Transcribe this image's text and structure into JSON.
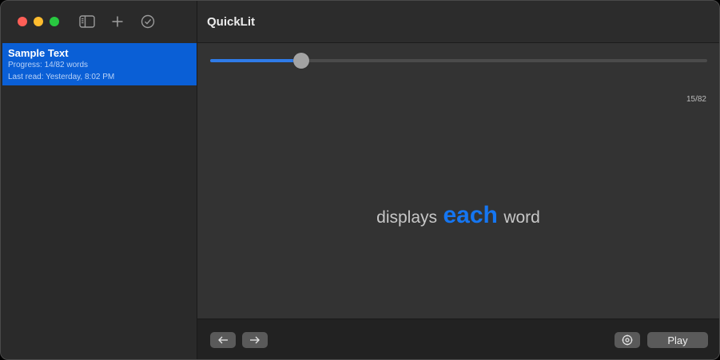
{
  "sidebar": {
    "toolbar": {
      "icons": [
        "sidebar-toggle-icon",
        "plus-icon",
        "checkmark-circle-icon"
      ]
    },
    "items": [
      {
        "title": "Sample Text",
        "progress": "Progress: 14/82 words",
        "last_read": "Last read: Yesterday, 8:02 PM",
        "selected": true
      }
    ]
  },
  "header": {
    "title": "QuickLit"
  },
  "reader": {
    "progress_fraction": 0.183,
    "counter": "15/82",
    "word_before": "displays",
    "word_focus": "each",
    "word_after": "word"
  },
  "controls": {
    "back_icon": "arrow-left-icon",
    "forward_icon": "arrow-right-icon",
    "settings_icon": "gear-icon",
    "play_label": "Play"
  },
  "colors": {
    "accent": "#1576f2",
    "selection": "#0a5fd6",
    "window_bg": "#333333"
  }
}
